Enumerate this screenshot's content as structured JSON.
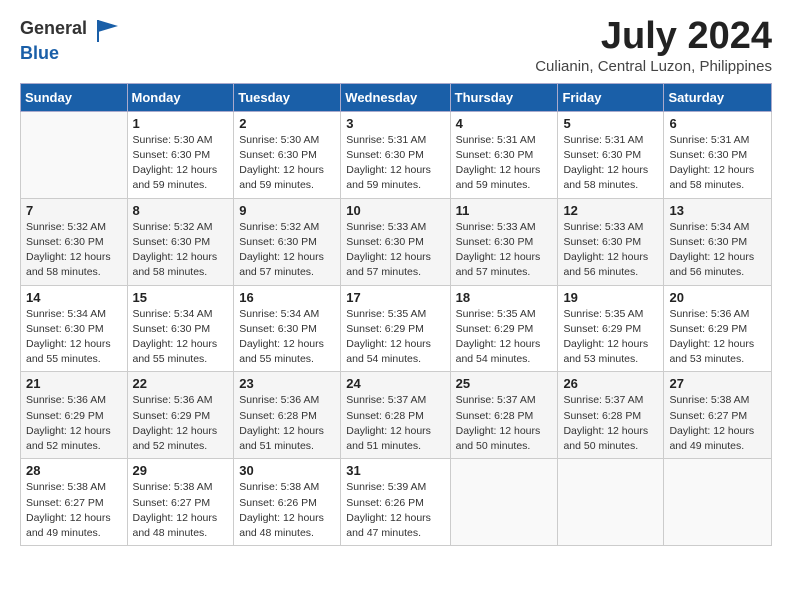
{
  "header": {
    "logo_general": "General",
    "logo_blue": "Blue",
    "month": "July 2024",
    "location": "Culianin, Central Luzon, Philippines"
  },
  "days_of_week": [
    "Sunday",
    "Monday",
    "Tuesday",
    "Wednesday",
    "Thursday",
    "Friday",
    "Saturday"
  ],
  "weeks": [
    [
      {
        "day": "",
        "info": ""
      },
      {
        "day": "1",
        "info": "Sunrise: 5:30 AM\nSunset: 6:30 PM\nDaylight: 12 hours\nand 59 minutes."
      },
      {
        "day": "2",
        "info": "Sunrise: 5:30 AM\nSunset: 6:30 PM\nDaylight: 12 hours\nand 59 minutes."
      },
      {
        "day": "3",
        "info": "Sunrise: 5:31 AM\nSunset: 6:30 PM\nDaylight: 12 hours\nand 59 minutes."
      },
      {
        "day": "4",
        "info": "Sunrise: 5:31 AM\nSunset: 6:30 PM\nDaylight: 12 hours\nand 59 minutes."
      },
      {
        "day": "5",
        "info": "Sunrise: 5:31 AM\nSunset: 6:30 PM\nDaylight: 12 hours\nand 58 minutes."
      },
      {
        "day": "6",
        "info": "Sunrise: 5:31 AM\nSunset: 6:30 PM\nDaylight: 12 hours\nand 58 minutes."
      }
    ],
    [
      {
        "day": "7",
        "info": "Sunrise: 5:32 AM\nSunset: 6:30 PM\nDaylight: 12 hours\nand 58 minutes."
      },
      {
        "day": "8",
        "info": "Sunrise: 5:32 AM\nSunset: 6:30 PM\nDaylight: 12 hours\nand 58 minutes."
      },
      {
        "day": "9",
        "info": "Sunrise: 5:32 AM\nSunset: 6:30 PM\nDaylight: 12 hours\nand 57 minutes."
      },
      {
        "day": "10",
        "info": "Sunrise: 5:33 AM\nSunset: 6:30 PM\nDaylight: 12 hours\nand 57 minutes."
      },
      {
        "day": "11",
        "info": "Sunrise: 5:33 AM\nSunset: 6:30 PM\nDaylight: 12 hours\nand 57 minutes."
      },
      {
        "day": "12",
        "info": "Sunrise: 5:33 AM\nSunset: 6:30 PM\nDaylight: 12 hours\nand 56 minutes."
      },
      {
        "day": "13",
        "info": "Sunrise: 5:34 AM\nSunset: 6:30 PM\nDaylight: 12 hours\nand 56 minutes."
      }
    ],
    [
      {
        "day": "14",
        "info": "Sunrise: 5:34 AM\nSunset: 6:30 PM\nDaylight: 12 hours\nand 55 minutes."
      },
      {
        "day": "15",
        "info": "Sunrise: 5:34 AM\nSunset: 6:30 PM\nDaylight: 12 hours\nand 55 minutes."
      },
      {
        "day": "16",
        "info": "Sunrise: 5:34 AM\nSunset: 6:30 PM\nDaylight: 12 hours\nand 55 minutes."
      },
      {
        "day": "17",
        "info": "Sunrise: 5:35 AM\nSunset: 6:29 PM\nDaylight: 12 hours\nand 54 minutes."
      },
      {
        "day": "18",
        "info": "Sunrise: 5:35 AM\nSunset: 6:29 PM\nDaylight: 12 hours\nand 54 minutes."
      },
      {
        "day": "19",
        "info": "Sunrise: 5:35 AM\nSunset: 6:29 PM\nDaylight: 12 hours\nand 53 minutes."
      },
      {
        "day": "20",
        "info": "Sunrise: 5:36 AM\nSunset: 6:29 PM\nDaylight: 12 hours\nand 53 minutes."
      }
    ],
    [
      {
        "day": "21",
        "info": "Sunrise: 5:36 AM\nSunset: 6:29 PM\nDaylight: 12 hours\nand 52 minutes."
      },
      {
        "day": "22",
        "info": "Sunrise: 5:36 AM\nSunset: 6:29 PM\nDaylight: 12 hours\nand 52 minutes."
      },
      {
        "day": "23",
        "info": "Sunrise: 5:36 AM\nSunset: 6:28 PM\nDaylight: 12 hours\nand 51 minutes."
      },
      {
        "day": "24",
        "info": "Sunrise: 5:37 AM\nSunset: 6:28 PM\nDaylight: 12 hours\nand 51 minutes."
      },
      {
        "day": "25",
        "info": "Sunrise: 5:37 AM\nSunset: 6:28 PM\nDaylight: 12 hours\nand 50 minutes."
      },
      {
        "day": "26",
        "info": "Sunrise: 5:37 AM\nSunset: 6:28 PM\nDaylight: 12 hours\nand 50 minutes."
      },
      {
        "day": "27",
        "info": "Sunrise: 5:38 AM\nSunset: 6:27 PM\nDaylight: 12 hours\nand 49 minutes."
      }
    ],
    [
      {
        "day": "28",
        "info": "Sunrise: 5:38 AM\nSunset: 6:27 PM\nDaylight: 12 hours\nand 49 minutes."
      },
      {
        "day": "29",
        "info": "Sunrise: 5:38 AM\nSunset: 6:27 PM\nDaylight: 12 hours\nand 48 minutes."
      },
      {
        "day": "30",
        "info": "Sunrise: 5:38 AM\nSunset: 6:26 PM\nDaylight: 12 hours\nand 48 minutes."
      },
      {
        "day": "31",
        "info": "Sunrise: 5:39 AM\nSunset: 6:26 PM\nDaylight: 12 hours\nand 47 minutes."
      },
      {
        "day": "",
        "info": ""
      },
      {
        "day": "",
        "info": ""
      },
      {
        "day": "",
        "info": ""
      }
    ]
  ]
}
